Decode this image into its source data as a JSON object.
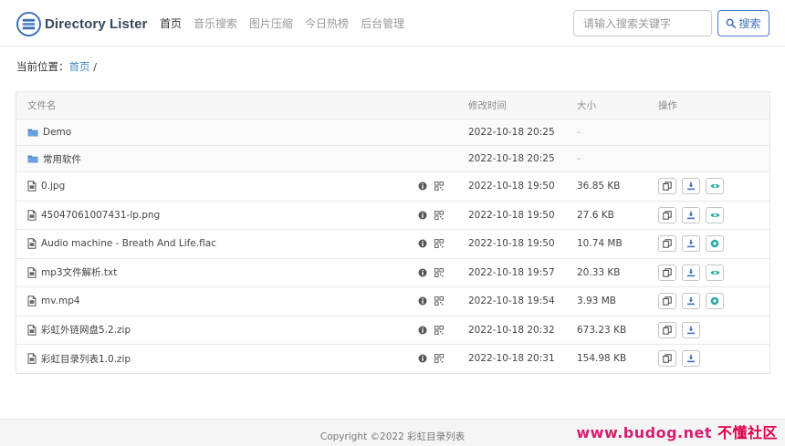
{
  "brand": {
    "name": "Directory Lister"
  },
  "nav": [
    {
      "label": "首页",
      "active": true
    },
    {
      "label": "音乐搜索"
    },
    {
      "label": "图片压缩"
    },
    {
      "label": "今日热榜"
    },
    {
      "label": "后台管理"
    }
  ],
  "search": {
    "placeholder": "请输入搜索关键字",
    "button_label": "搜索"
  },
  "breadcrumb": {
    "prefix": "当前位置：",
    "home": "首页",
    "sep": "/"
  },
  "table": {
    "headers": {
      "name": "文件名",
      "time": "修改时间",
      "size": "大小",
      "ops": "操作"
    },
    "folders": [
      {
        "name": "Demo",
        "time": "2022-10-18 20:25",
        "size": "-"
      },
      {
        "name": "常用软件",
        "time": "2022-10-18 20:25",
        "size": "-"
      }
    ],
    "files": [
      {
        "name": "0.jpg",
        "time": "2022-10-18 19:50",
        "size": "36.85 KB",
        "icon": "image-file-icon",
        "preview": "eye"
      },
      {
        "name": "45047061007431-lp.png",
        "time": "2022-10-18 19:50",
        "size": "27.6 KB",
        "icon": "image-file-icon",
        "preview": "eye"
      },
      {
        "name": "Audio machine - Breath And Life.flac",
        "time": "2022-10-18 19:50",
        "size": "10.74 MB",
        "icon": "audio-file-icon",
        "preview": "play"
      },
      {
        "name": "mp3文件解析.txt",
        "time": "2022-10-18 19:57",
        "size": "20.33 KB",
        "icon": "text-file-icon",
        "preview": "eye"
      },
      {
        "name": "mv.mp4",
        "time": "2022-10-18 19:54",
        "size": "3.93 MB",
        "icon": "video-file-icon",
        "preview": "play"
      },
      {
        "name": "彩虹外链网盘5.2.zip",
        "time": "2022-10-18 20:32",
        "size": "673.23 KB",
        "icon": "zip-file-icon",
        "preview": ""
      },
      {
        "name": "彩虹目录列表1.0.zip",
        "time": "2022-10-18 20:31",
        "size": "154.98 KB",
        "icon": "zip-file-icon",
        "preview": ""
      }
    ]
  },
  "footer": {
    "copyright": "Copyright ©2022 彩虹目录列表"
  },
  "watermark": {
    "url": "www.budog.net",
    "cn": "不懂社区"
  },
  "colors": {
    "accent": "#428bca",
    "folder": "#4a86c8",
    "preview_green": "#2eaaa0"
  }
}
